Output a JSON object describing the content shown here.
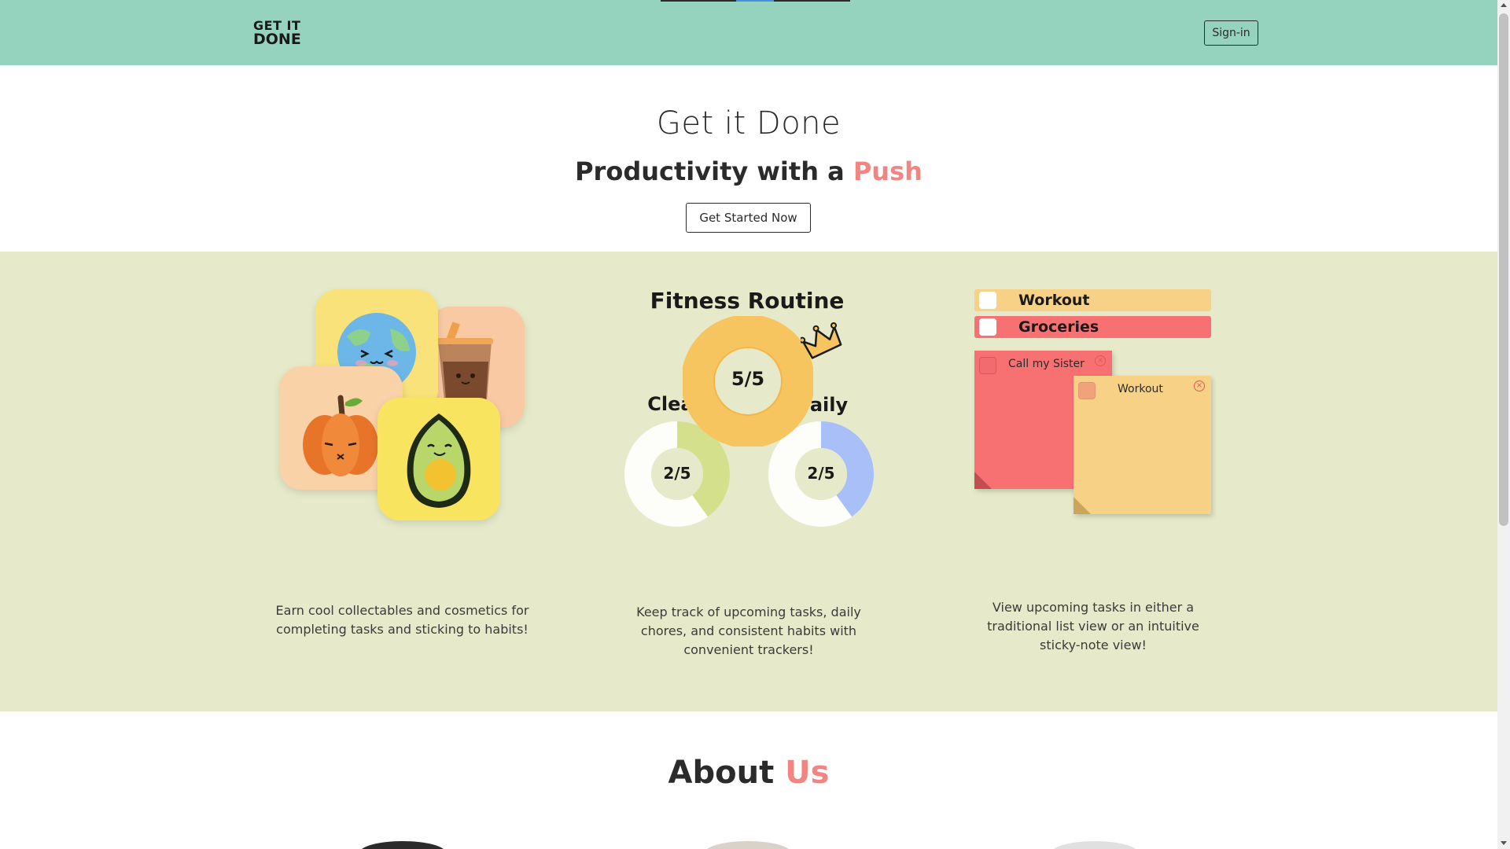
{
  "nav": {
    "logo_line1": "GET IT",
    "logo_line2": "DONE",
    "signin_label": "Sign-in"
  },
  "hero": {
    "title": "Get it Done",
    "subtitle_prefix": "Productivity with a ",
    "subtitle_accent": "Push",
    "cta_label": "Get Started Now"
  },
  "features": {
    "collectables_text": "Earn cool collectables and cosmetics for completing tasks and sticking to habits!",
    "trackers_text": "Keep track of upcoming tasks, daily chores, and consistent habits with convenient trackers!",
    "views_text": "View upcoming tasks in either a traditional list view or an intuitive sticky-note view!",
    "tracker": {
      "main_title": "Fitness Routine",
      "main_value": "5/5",
      "main_progress": 1.0,
      "left_title": "Clean",
      "left_value": "2/5",
      "left_progress": 0.4,
      "right_title": "Daily",
      "right_value": "2/5",
      "right_progress": 0.4
    },
    "list_view": [
      {
        "label": "Workout"
      },
      {
        "label": "Groceries"
      }
    ],
    "sticky_notes": [
      {
        "label": "Call my Sister"
      },
      {
        "label": "Workout"
      }
    ]
  },
  "about": {
    "title_prefix": "About ",
    "title_accent": "Us"
  },
  "colors": {
    "navbar": "#95d3be",
    "features_bg": "#e7eaca",
    "accent": "#f28482",
    "tracker_main": "#f7c55f",
    "tracker_left": "#d4e08c",
    "tracker_right": "#a8c0f7",
    "list_yellow": "#f6d186",
    "list_red": "#f77173"
  },
  "icons": {
    "crown": "crown-icon",
    "close": "close-icon"
  }
}
